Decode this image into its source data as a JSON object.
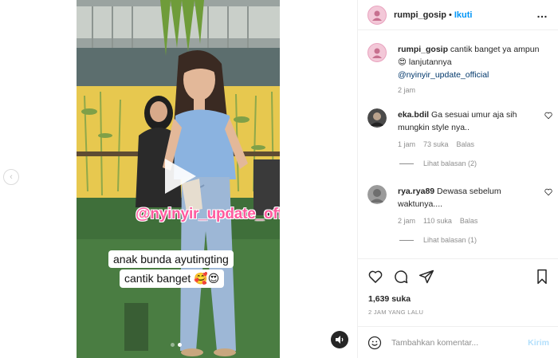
{
  "media": {
    "watermark": "@nyinyir_update_official",
    "caption_line1": "anak bunda ayutingting",
    "caption_line2": "cantik banget 🥰😍",
    "carousel_dots": 2,
    "active_dot": 1
  },
  "header": {
    "username": "rumpi_gosip",
    "separator": "•",
    "follow_label": "Ikuti",
    "more_label": "…"
  },
  "post_caption": {
    "username": "rumpi_gosip",
    "text": " cantik banget ya ampun 😍 lanjutannya",
    "mention": "@nyinyir_update_official",
    "time": "2 jam"
  },
  "comments": [
    {
      "username": "eka.bdil",
      "text": " Ga sesuai umur aja sih mungkin style nya..",
      "time": "1 jam",
      "likes": "73 suka",
      "reply_label": "Balas",
      "view_replies": "Lihat balasan (2)"
    },
    {
      "username": "rya.rya89",
      "text": " Dewasa sebelum waktunya....",
      "time": "2 jam",
      "likes": "110 suka",
      "reply_label": "Balas",
      "view_replies": "Lihat balasan (1)"
    }
  ],
  "actions": {
    "likes": "1,639 suka",
    "time_ago": "2 JAM YANG LALU"
  },
  "add_comment": {
    "placeholder": "Tambahkan komentar...",
    "post_label": "Kirim"
  },
  "colors": {
    "accent": "#0095f6",
    "watermark": "#ff5a9e",
    "post_disabled": "#b2dffc"
  },
  "icons": [
    "chevron-left-icon",
    "play-icon",
    "audio-icon",
    "more-icon",
    "heart-icon",
    "comment-icon",
    "share-icon",
    "bookmark-icon",
    "emoji-icon"
  ]
}
